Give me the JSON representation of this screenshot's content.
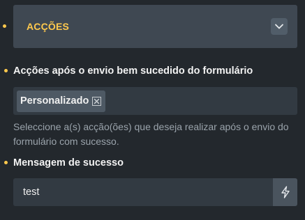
{
  "section": {
    "title": "ACÇÕES",
    "toggle_icon": "chevron-down-icon"
  },
  "actions_field": {
    "label": "Acções após o envio bem sucedido do formulário",
    "tags": [
      {
        "label": "Personalizado",
        "remove_icon": "close-square-icon"
      }
    ],
    "help": "Seleccione a(s) acção(ões) que deseja realizar após o envio do formulário com sucesso."
  },
  "success_message_field": {
    "label": "Mensagem de sucesso",
    "value": "test",
    "dynamic_icon": "lightning-bolt-icon"
  },
  "colors": {
    "accent": "#ffc94d",
    "background": "#23282d",
    "panel": "#3f4852",
    "input": "#323a42"
  }
}
